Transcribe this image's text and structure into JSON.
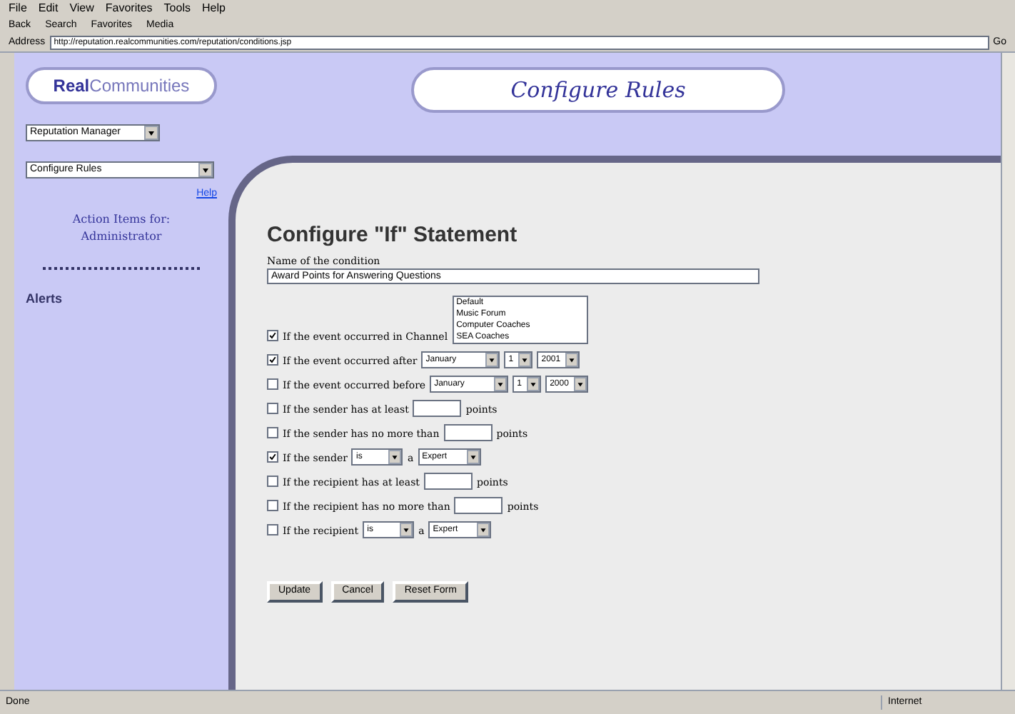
{
  "menu": [
    "File",
    "Edit",
    "View",
    "Favorites",
    "Tools",
    "Help"
  ],
  "toolbar": [
    "Back",
    "Search",
    "Favorites",
    "Media"
  ],
  "address": {
    "label": "Address",
    "value": "http://reputation.realcommunities.com/reputation/conditions.jsp",
    "go": "Go"
  },
  "logo": {
    "part_1": "Real",
    "part_2": "Communities"
  },
  "header_title": "Configure Rules",
  "sidebar": {
    "selects": [
      "Reputation Manager",
      "Configure Rules"
    ],
    "help": "Help",
    "action_items": "Action Items for: Administrator",
    "alerts": "Alerts"
  },
  "form": {
    "heading": "Configure \"If\" Statement",
    "name_label": "Name of the condition",
    "name_value": "Award Points for Answering Questions",
    "conditions": [
      {
        "kind": "channel",
        "checked": true,
        "label": "If the event occurred in Channel",
        "options": [
          "Default",
          "Music Forum",
          "Computer Coaches",
          "SEA Coaches"
        ]
      },
      {
        "kind": "date",
        "checked": true,
        "label": "If the event occurred after",
        "month": "January",
        "day": "1",
        "year": "2001"
      },
      {
        "kind": "date",
        "checked": false,
        "label": "If the event occurred before",
        "month": "January",
        "day": "1",
        "year": "2000"
      },
      {
        "kind": "points",
        "checked": false,
        "label": "If the sender has at least",
        "suffix": "points"
      },
      {
        "kind": "points",
        "checked": false,
        "label": "If the sender has no more than",
        "suffix": "points"
      },
      {
        "kind": "rank",
        "checked": true,
        "label": "If the sender",
        "operator": "is",
        "joiner": "a",
        "rank": "Expert"
      },
      {
        "kind": "points",
        "checked": false,
        "label": "If the recipient has at least",
        "suffix": "points"
      },
      {
        "kind": "points",
        "checked": false,
        "label": "If the recipient has no more than",
        "suffix": "points"
      },
      {
        "kind": "rank",
        "checked": false,
        "label": "If the recipient",
        "operator": "is",
        "joiner": "a",
        "rank": "Expert"
      }
    ],
    "buttons": [
      "Update",
      "Cancel",
      "Reset Form"
    ]
  },
  "status_bar": {
    "text": "Done",
    "zone": "Internet"
  }
}
